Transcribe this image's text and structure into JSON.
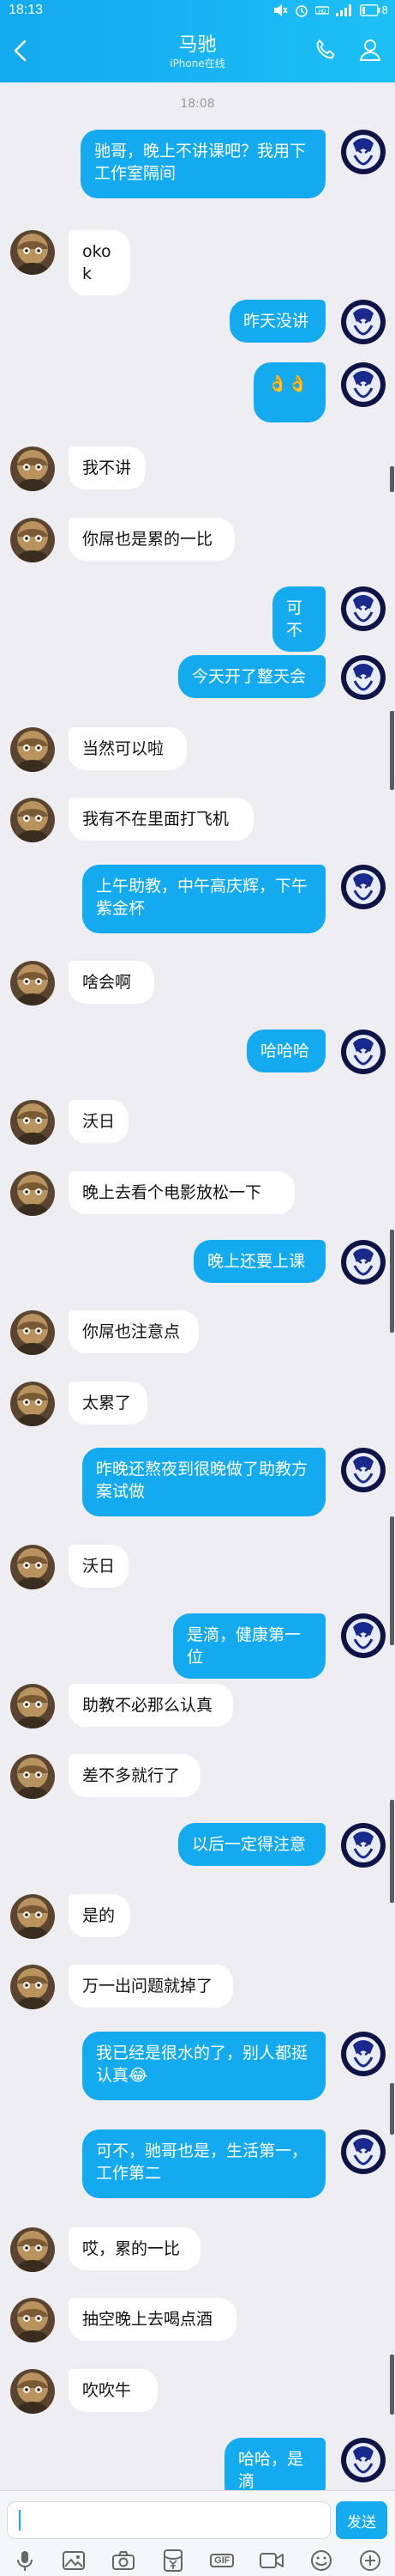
{
  "status_bar": {
    "time": "18:13",
    "battery": "8"
  },
  "header": {
    "title": "马驰",
    "subtitle": "iPhone在线"
  },
  "chat": {
    "timestamp": "18:08",
    "messages": [
      {
        "side": "right",
        "text": "驰哥，晚上不讲课吧？我用下工作室隔间"
      },
      {
        "side": "left",
        "text": "okok"
      },
      {
        "side": "right",
        "text": "昨天没讲"
      },
      {
        "side": "right",
        "text": "👌👌"
      },
      {
        "side": "left",
        "text": "我不讲"
      },
      {
        "side": "left",
        "text": "你屌也是累的一比"
      },
      {
        "side": "right",
        "text": "可不"
      },
      {
        "side": "right",
        "text": "今天开了整天会"
      },
      {
        "side": "left",
        "text": "当然可以啦"
      },
      {
        "side": "left",
        "text": "我有不在里面打飞机"
      },
      {
        "side": "right",
        "text": "上午助教，中午高庆辉，下午紫金杯"
      },
      {
        "side": "left",
        "text": "啥会啊"
      },
      {
        "side": "right",
        "text": "哈哈哈"
      },
      {
        "side": "left",
        "text": "沃日"
      },
      {
        "side": "left",
        "text": "晚上去看个电影放松一下"
      },
      {
        "side": "right",
        "text": "晚上还要上课"
      },
      {
        "side": "left",
        "text": "你屌也注意点"
      },
      {
        "side": "left",
        "text": "太累了"
      },
      {
        "side": "right",
        "text": "昨晚还熬夜到很晚做了助教方案试做"
      },
      {
        "side": "left",
        "text": "沃日"
      },
      {
        "side": "right",
        "text": "是滴，健康第一位"
      },
      {
        "side": "left",
        "text": "助教不必那么认真"
      },
      {
        "side": "left",
        "text": "差不多就行了"
      },
      {
        "side": "right",
        "text": "以后一定得注意"
      },
      {
        "side": "left",
        "text": "是的"
      },
      {
        "side": "left",
        "text": "万一出问题就掉了"
      },
      {
        "side": "right",
        "text": "我已经是很水的了，别人都挺认真😂"
      },
      {
        "side": "right",
        "text": "可不，驰哥也是，生活第一，工作第二"
      },
      {
        "side": "left",
        "text": "哎，累的一比"
      },
      {
        "side": "left",
        "text": "抽空晚上去喝点酒"
      },
      {
        "side": "left",
        "text": "吹吹牛"
      },
      {
        "side": "right",
        "text": "哈哈，是滴"
      }
    ]
  },
  "input": {
    "value": "",
    "placeholder": "",
    "send_label": "发送"
  },
  "toolbar": {
    "items": [
      "mic-icon",
      "image-icon",
      "camera-icon",
      "red-packet-icon",
      "gif-icon",
      "video-icon",
      "emoji-icon",
      "plus-icon"
    ],
    "gif_label": "GIF"
  },
  "colors": {
    "header_gradient": [
      "#14a9ef",
      "#1cc0f5"
    ],
    "bubble_self": "#14aaf0",
    "bubble_other": "#ffffff",
    "background": "#ededf2"
  }
}
